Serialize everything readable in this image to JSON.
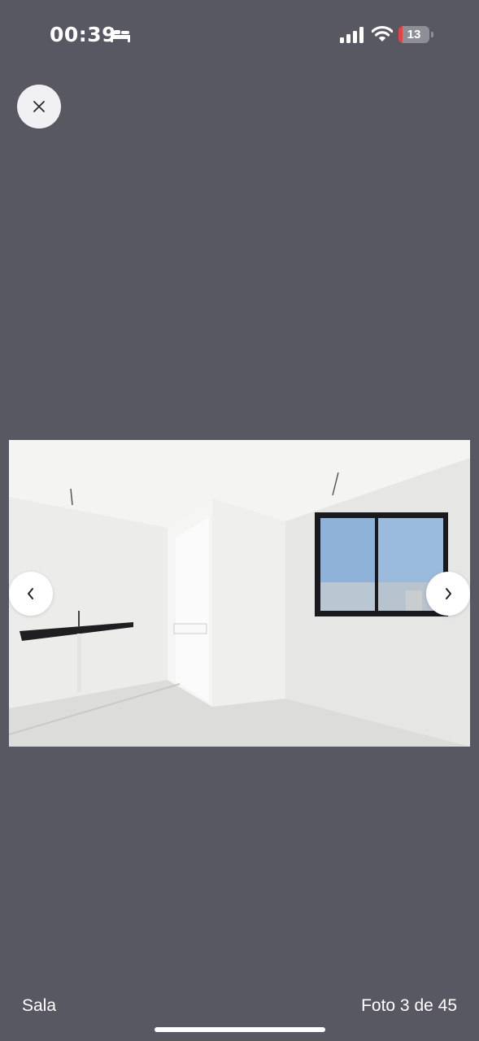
{
  "status_bar": {
    "time": "00:39",
    "sleep_icon": "bed-icon",
    "signal_icon": "cellular-signal-icon",
    "wifi_icon": "wifi-icon",
    "battery_level": "13",
    "battery_fraction": 0.13,
    "battery_color": "#e8423f"
  },
  "viewer": {
    "close_icon": "close-icon",
    "prev_icon": "chevron-left-icon",
    "next_icon": "chevron-right-icon",
    "background": "#585863"
  },
  "footer": {
    "caption": "Sala",
    "counter": "Foto 3 de 45"
  }
}
